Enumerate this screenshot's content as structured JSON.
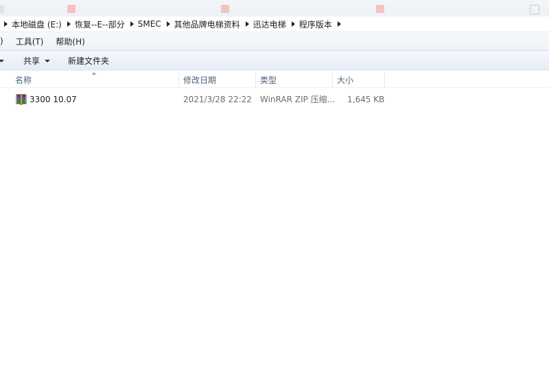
{
  "breadcrumb": [
    "本地磁盘 (E:)",
    "恢复--E--部分",
    "SMEC",
    "其他品牌电梯资料",
    "迅达电梯",
    "程序版本"
  ],
  "menu": {
    "partial": ")",
    "tools": "工具(T)",
    "help": "帮助(H)"
  },
  "toolbar": {
    "share": "共享",
    "new_folder": "新建文件夹"
  },
  "columns": {
    "name": "名称",
    "modified": "修改日期",
    "type": "类型",
    "size": "大小"
  },
  "files": [
    {
      "name": "3300 10.07",
      "modified": "2021/3/28 22:22",
      "type": "WinRAR ZIP 压缩...",
      "size": "1,645 KB",
      "icon": "winrar-archive-icon"
    }
  ]
}
